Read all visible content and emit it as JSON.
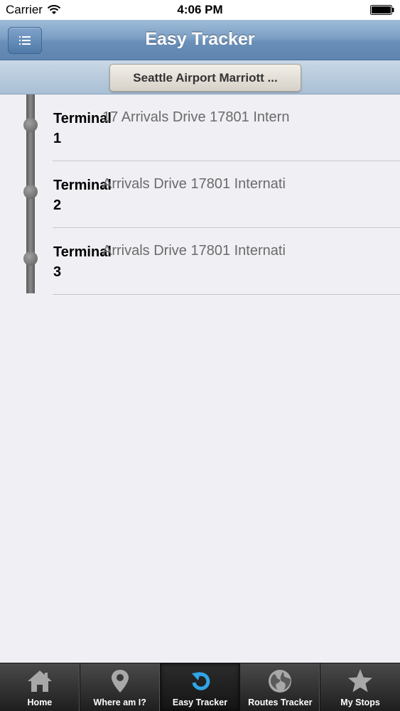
{
  "status_bar": {
    "carrier": "Carrier",
    "time": "4:06 PM"
  },
  "nav": {
    "title": "Easy Tracker"
  },
  "sub_bar": {
    "hotel_label": "Seattle Airport Marriott ..."
  },
  "stops": [
    {
      "name": "Terminal 1",
      "address": "17 Arrivals Drive 17801 Intern"
    },
    {
      "name": "Terminal 2",
      "address": "Arrivals Drive 17801 Internati"
    },
    {
      "name": "Terminal 3",
      "address": "Arrivals Drive 17801 Internati"
    }
  ],
  "tabs": [
    {
      "label": "Home",
      "icon": "home-icon"
    },
    {
      "label": "Where am I?",
      "icon": "map-pin-icon"
    },
    {
      "label": "Easy Tracker",
      "icon": "refresh-icon",
      "active": true
    },
    {
      "label": "Routes Tracker",
      "icon": "globe-icon"
    },
    {
      "label": "My Stops",
      "icon": "star-icon"
    }
  ],
  "colors": {
    "nav_bar": "#6a8fb8",
    "tab_bar": "#1e1e1e",
    "active_icon": "#2fa6e8",
    "inactive_icon": "#a8a8a8"
  }
}
